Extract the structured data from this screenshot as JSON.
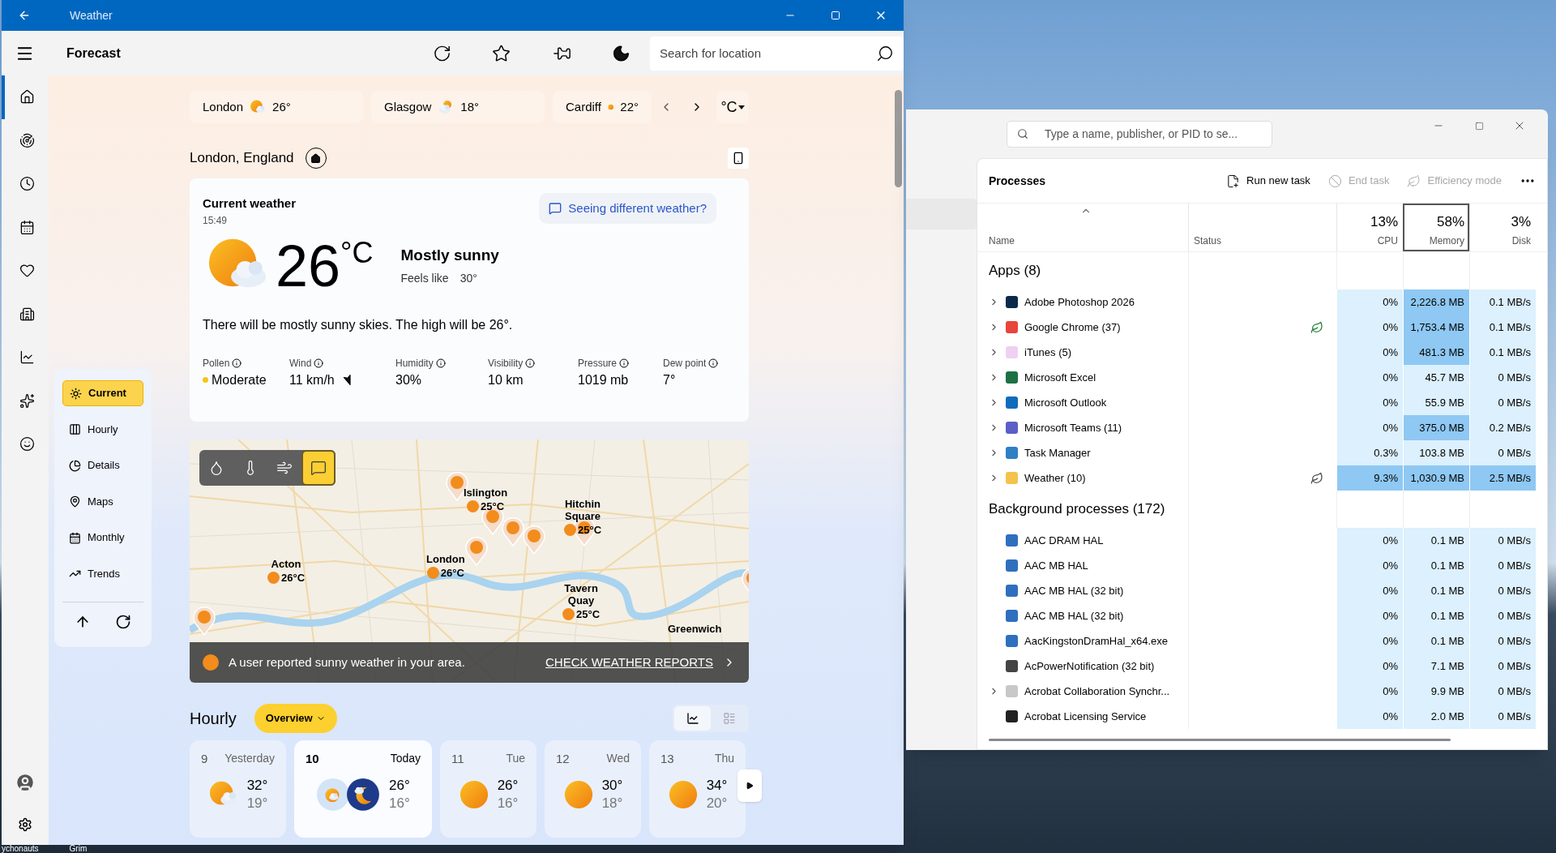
{
  "desktop": {
    "labels": [
      "ychonauts",
      "Grim"
    ]
  },
  "weather_window": {
    "title": "Weather",
    "toolbar": {
      "title": "Forecast",
      "search": {
        "placeholder": "Search for location"
      }
    },
    "nav_rail": [
      {
        "selected": true
      },
      {
        "selected": false
      },
      {
        "selected": false
      },
      {
        "selected": false
      },
      {
        "selected": false
      },
      {
        "selected": false
      },
      {
        "selected": false
      },
      {
        "selected": false
      },
      {
        "selected": false
      }
    ],
    "favorites": [
      {
        "city": "London",
        "temp": "26°",
        "kind": "partly_cloudy"
      },
      {
        "city": "Glasgow",
        "temp": "18°",
        "kind": "cloudy"
      },
      {
        "city": "Cardiff",
        "temp": "22°",
        "kind": "sunny"
      }
    ],
    "unit": "°C",
    "location": "London, England",
    "current": {
      "title": "Current weather",
      "time": "15:49",
      "temp": "26",
      "unit": "°C",
      "condition": "Mostly sunny",
      "feels_like_label": "Feels like",
      "feels_like": "30°",
      "feedback": "Seeing different weather?",
      "summary": "There will be mostly sunny skies. The high will be 26°.",
      "details": [
        {
          "label": "Pollen",
          "value": "Moderate",
          "kind": "pollen"
        },
        {
          "label": "Wind",
          "value": "11 km/h",
          "kind": "wind"
        },
        {
          "label": "Humidity",
          "value": "30%",
          "kind": "plain"
        },
        {
          "label": "Visibility",
          "value": "10 km",
          "kind": "plain"
        },
        {
          "label": "Pressure",
          "value": "1019 mb",
          "kind": "plain"
        },
        {
          "label": "Dew point",
          "value": "7°",
          "kind": "plain"
        }
      ]
    },
    "sections": [
      {
        "label": "Current",
        "selected": true
      },
      {
        "label": "Hourly",
        "selected": false
      },
      {
        "label": "Details",
        "selected": false
      },
      {
        "label": "Maps",
        "selected": false
      },
      {
        "label": "Monthly",
        "selected": false
      },
      {
        "label": "Trends",
        "selected": false
      }
    ],
    "map": {
      "layers": [
        {
          "selected": false
        },
        {
          "selected": false
        },
        {
          "selected": false
        },
        {
          "selected": true
        }
      ],
      "places": [
        {
          "name": "Islington",
          "temp": "25°C"
        },
        {
          "name": "Hitchin Square",
          "temp": "25°C"
        },
        {
          "name": "Acton",
          "temp": "26°C"
        },
        {
          "name": "London",
          "temp": "26°C"
        },
        {
          "name": "Tavern Quay",
          "temp": "25°C"
        },
        {
          "name": "Greenwich"
        }
      ],
      "banner": {
        "text": "A user reported sunny weather in your area.",
        "link": "CHECK WEATHER REPORTS"
      }
    },
    "hourly": {
      "title": "Hourly",
      "mode": "Overview",
      "views": [
        {
          "selected": true
        },
        {
          "selected": false
        }
      ],
      "days": [
        {
          "date": "9",
          "label": "Yesterday",
          "high": "32°",
          "low": "19°",
          "kind": "partly_cloudy",
          "selected": false
        },
        {
          "date": "10",
          "label": "Today",
          "high": "26°",
          "low": "16°",
          "kind": "day_night",
          "selected": true
        },
        {
          "date": "11",
          "label": "Tue",
          "high": "26°",
          "low": "16°",
          "kind": "sunny",
          "selected": false
        },
        {
          "date": "12",
          "label": "Wed",
          "high": "30°",
          "low": "18°",
          "kind": "sunny",
          "selected": false
        },
        {
          "date": "13",
          "label": "Thu",
          "high": "34°",
          "low": "20°",
          "kind": "sunny",
          "selected": false
        }
      ]
    }
  },
  "task_manager": {
    "search": {
      "placeholder": "Type a name, publisher, or PID to se..."
    },
    "title": "Processes",
    "actions": [
      {
        "label": "Run new task",
        "disabled": false
      },
      {
        "label": "End task",
        "disabled": true
      },
      {
        "label": "Efficiency mode",
        "disabled": true
      }
    ],
    "columns": [
      {
        "name": "Name"
      },
      {
        "name": "Status"
      },
      {
        "total": "13%",
        "name": "CPU",
        "selected": false
      },
      {
        "total": "58%",
        "name": "Memory",
        "selected": true
      },
      {
        "total": "3%",
        "name": "Disk",
        "selected": false
      }
    ],
    "groups": [
      {
        "title": "Apps (8)",
        "rows": [
          {
            "name": "Adobe Photoshop 2026",
            "expandable": true,
            "efficiency_mode": false,
            "cpu": "0%",
            "memory": "2,226.8 MB",
            "disk": "0.1 MB/s",
            "mem_high": true,
            "highlighted": false
          },
          {
            "name": "Google Chrome (37)",
            "expandable": true,
            "efficiency_mode": true,
            "cpu": "0%",
            "memory": "1,753.4 MB",
            "disk": "0.1 MB/s",
            "mem_high": true,
            "highlighted": false
          },
          {
            "name": "iTunes (5)",
            "expandable": true,
            "efficiency_mode": false,
            "cpu": "0%",
            "memory": "481.3 MB",
            "disk": "0.1 MB/s",
            "mem_high": true,
            "highlighted": false
          },
          {
            "name": "Microsoft Excel",
            "expandable": true,
            "efficiency_mode": false,
            "cpu": "0%",
            "memory": "45.7 MB",
            "disk": "0 MB/s",
            "mem_high": false,
            "highlighted": false
          },
          {
            "name": "Microsoft Outlook",
            "expandable": true,
            "efficiency_mode": false,
            "cpu": "0%",
            "memory": "55.9 MB",
            "disk": "0 MB/s",
            "mem_high": false,
            "highlighted": false
          },
          {
            "name": "Microsoft Teams (11)",
            "expandable": true,
            "efficiency_mode": false,
            "cpu": "0%",
            "memory": "375.0 MB",
            "disk": "0.2 MB/s",
            "mem_high": true,
            "highlighted": false
          },
          {
            "name": "Task Manager",
            "expandable": true,
            "efficiency_mode": false,
            "cpu": "0.3%",
            "memory": "103.8 MB",
            "disk": "0 MB/s",
            "mem_high": false,
            "highlighted": false
          },
          {
            "name": "Weather (10)",
            "expandable": true,
            "efficiency_mode": true,
            "cpu": "9.3%",
            "memory": "1,030.9 MB",
            "disk": "2.5 MB/s",
            "mem_high": true,
            "highlighted": true
          }
        ]
      },
      {
        "title": "Background processes (172)",
        "rows": [
          {
            "name": "AAC DRAM HAL",
            "expandable": false,
            "efficiency_mode": false,
            "cpu": "0%",
            "memory": "0.1 MB",
            "disk": "0 MB/s",
            "mem_high": false,
            "highlighted": false
          },
          {
            "name": "AAC MB HAL",
            "expandable": false,
            "efficiency_mode": false,
            "cpu": "0%",
            "memory": "0.1 MB",
            "disk": "0 MB/s",
            "mem_high": false,
            "highlighted": false
          },
          {
            "name": "AAC MB HAL (32 bit)",
            "expandable": false,
            "efficiency_mode": false,
            "cpu": "0%",
            "memory": "0.1 MB",
            "disk": "0 MB/s",
            "mem_high": false,
            "highlighted": false
          },
          {
            "name": "AAC MB HAL (32 bit)",
            "expandable": false,
            "efficiency_mode": false,
            "cpu": "0%",
            "memory": "0.1 MB",
            "disk": "0 MB/s",
            "mem_high": false,
            "highlighted": false
          },
          {
            "name": "AacKingstonDramHal_x64.exe",
            "expandable": false,
            "efficiency_mode": false,
            "cpu": "0%",
            "memory": "0.1 MB",
            "disk": "0 MB/s",
            "mem_high": false,
            "highlighted": false
          },
          {
            "name": "AcPowerNotification (32 bit)",
            "expandable": false,
            "efficiency_mode": false,
            "cpu": "0%",
            "memory": "7.1 MB",
            "disk": "0 MB/s",
            "mem_high": false,
            "highlighted": false
          },
          {
            "name": "Acrobat Collaboration Synchr...",
            "expandable": true,
            "efficiency_mode": false,
            "cpu": "0%",
            "memory": "9.9 MB",
            "disk": "0 MB/s",
            "mem_high": false,
            "highlighted": false
          },
          {
            "name": "Acrobat Licensing Service",
            "expandable": false,
            "efficiency_mode": false,
            "cpu": "0%",
            "memory": "2.0 MB",
            "disk": "0 MB/s",
            "mem_high": false,
            "highlighted": false
          }
        ]
      }
    ]
  }
}
